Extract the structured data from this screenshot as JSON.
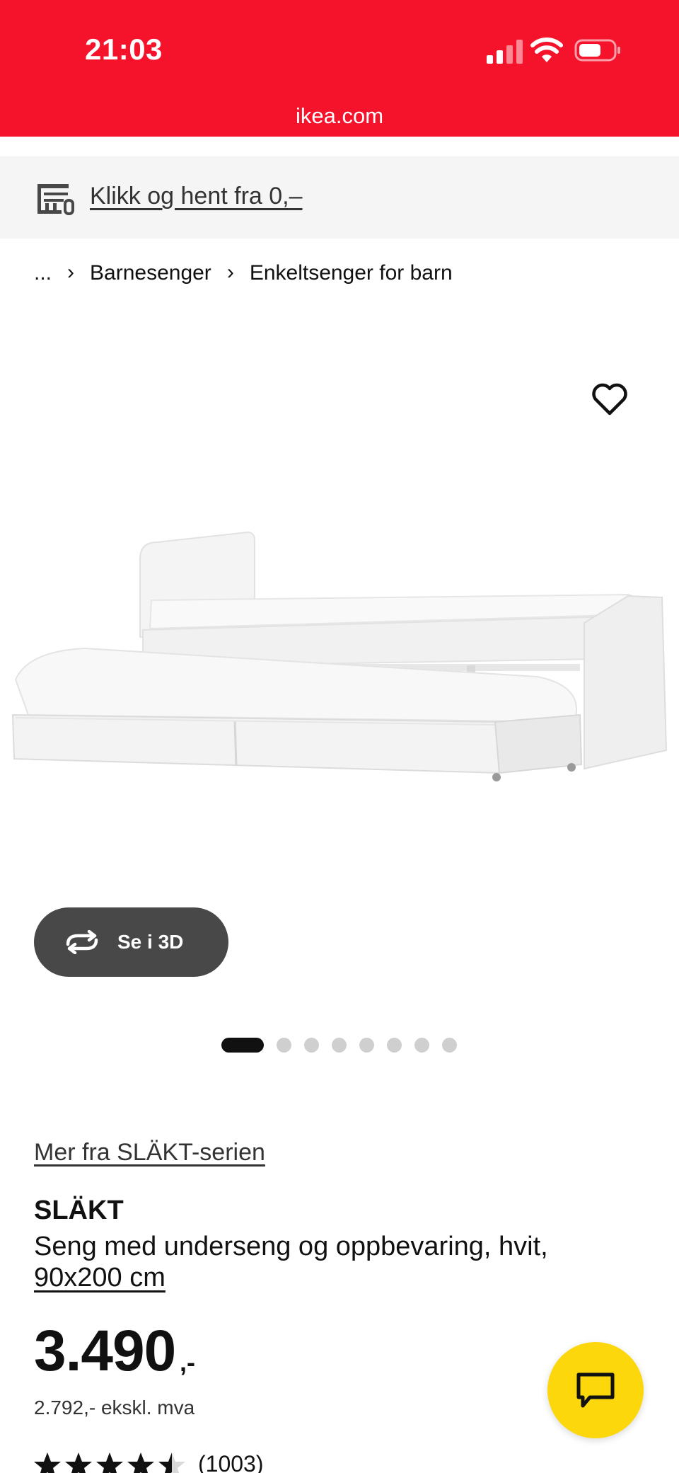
{
  "status_bar": {
    "time": "21:03",
    "url": "ikea.com",
    "accent_color": "#f5122b"
  },
  "pickup_banner": {
    "text": "Klikk og hent fra 0,–",
    "icon": "store-icon"
  },
  "breadcrumb": {
    "ellipsis": "...",
    "items": [
      "Barnesenger",
      "Enkeltsenger for barn"
    ]
  },
  "gallery": {
    "button_3d_label": "Se i 3D",
    "image_count": 8,
    "active_index": 0
  },
  "product": {
    "series_link": "Mer fra SLÄKT-serien",
    "name": "SLÄKT",
    "description": "Seng med underseng og oppbevaring, hvit,",
    "size": "90x200 cm",
    "price": "3.490",
    "price_suffix": ",-",
    "price_ex_vat": "2.792,- ekskl. mva",
    "rating": 4.5,
    "review_count": "(1003)"
  },
  "chat": {
    "icon": "chat-bubble-icon",
    "color": "#fcd70c"
  }
}
